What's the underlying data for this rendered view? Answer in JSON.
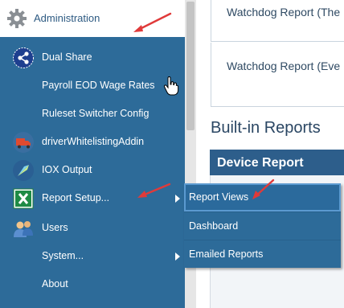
{
  "background_page": {
    "watchdog_1": "Watchdog Report (The",
    "watchdog_2": "Watchdog Report (Eve",
    "builtin_title": "Built-in Reports",
    "device_report": "Device Report"
  },
  "admin": {
    "label": "Administration",
    "icon": "gear-icon"
  },
  "menu": {
    "items": [
      {
        "label": "Dual Share",
        "icon": "share-icon"
      },
      {
        "label": "Payroll EOD Wage Rates"
      },
      {
        "label": "Ruleset Switcher Config"
      },
      {
        "label": "driverWhitelistingAddin",
        "icon": "truck-icon"
      },
      {
        "label": "IOX Output",
        "icon": "iox-icon"
      },
      {
        "label": "Report Setup...",
        "icon": "excel-icon",
        "has_submenu": true
      },
      {
        "label": "Users",
        "icon": "users-icon"
      },
      {
        "label": "System...",
        "has_submenu": true
      },
      {
        "label": "About"
      }
    ]
  },
  "submenu": {
    "items": [
      {
        "label": "Report Views"
      },
      {
        "label": "Dashboard"
      },
      {
        "label": "Emailed Reports"
      }
    ]
  },
  "colors": {
    "menu_bg": "#2d6b99",
    "header_text": "#2d5a82",
    "accent": "#5b9ad0",
    "annotation": "#e03a3a"
  }
}
